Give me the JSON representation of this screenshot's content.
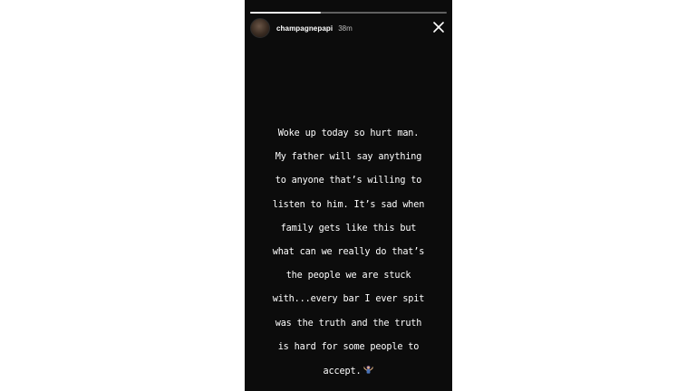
{
  "story": {
    "username": "champagnepapi",
    "timestamp": "38m",
    "progress": 0.36,
    "text_lines": [
      "Woke up today so hurt man.",
      "My father will say anything",
      "to anyone that’s willing to",
      "listen to him. It’s sad when",
      "family gets like this but",
      "what can we really do that’s",
      "the people we are stuck",
      "with...every bar I ever spit",
      "was the truth and the truth",
      "is hard for some people to",
      "accept."
    ],
    "emoji": "shrug-emoji-icon"
  },
  "colors": {
    "background": "#0c0c0c",
    "text": "#ffffff",
    "timestamp": "#bdbdbd"
  }
}
